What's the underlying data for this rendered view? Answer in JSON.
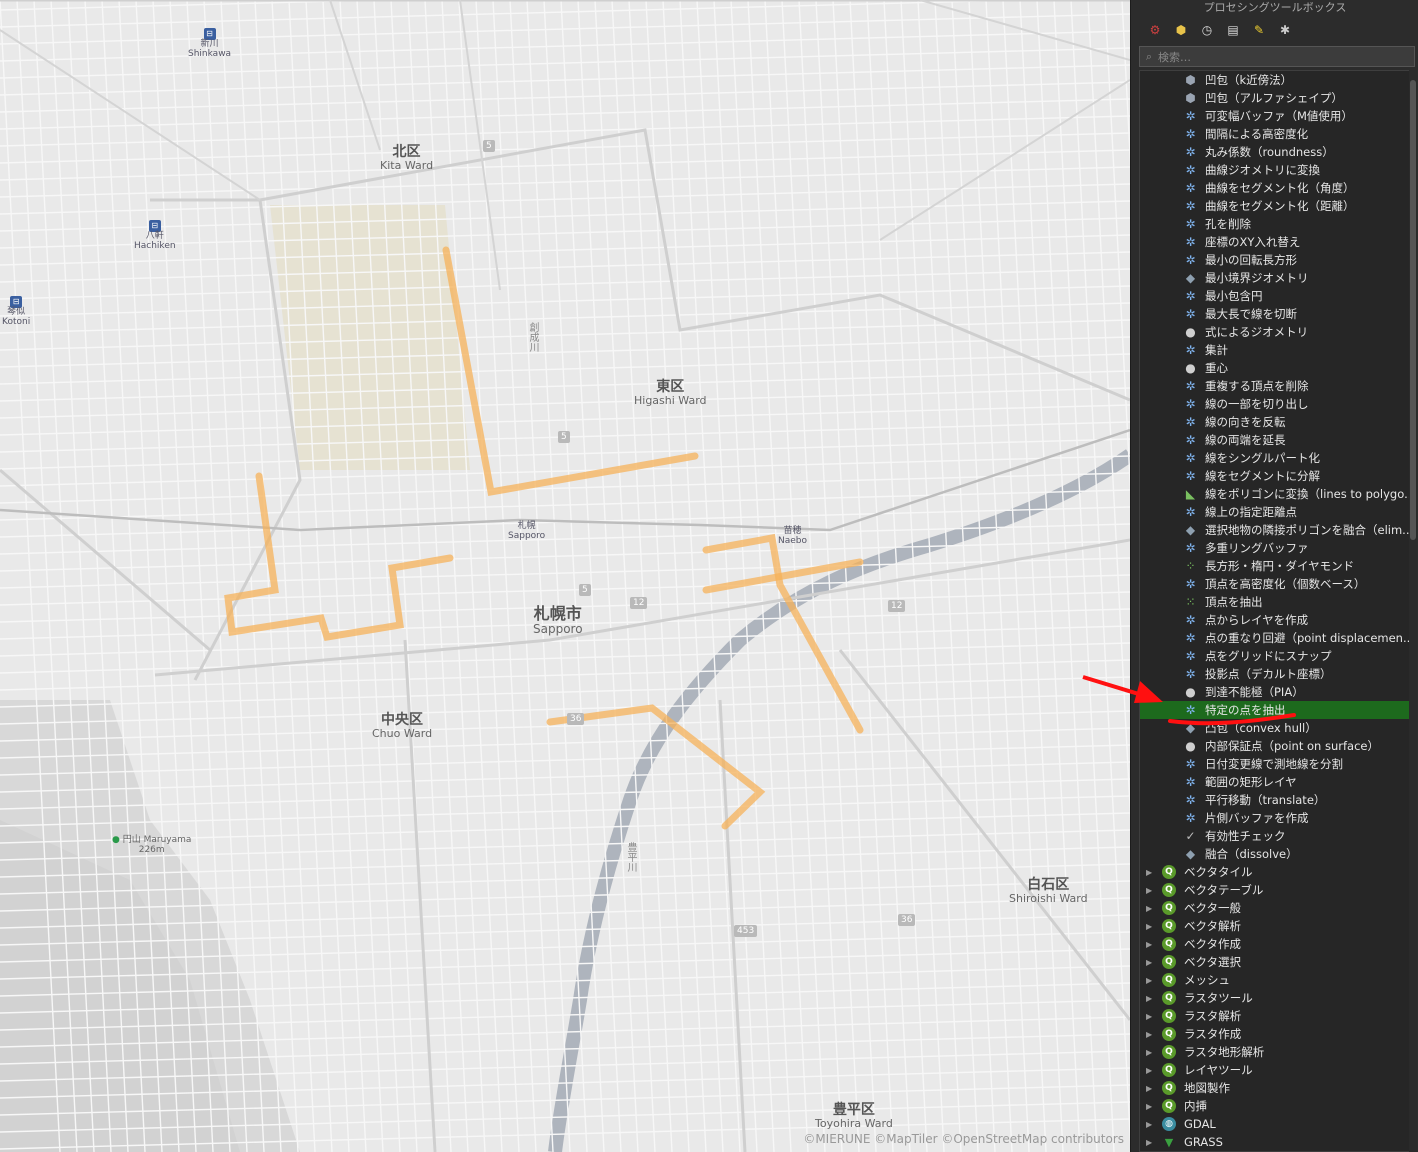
{
  "map": {
    "districts": [
      {
        "jp": "北区",
        "en": "Kita Ward"
      },
      {
        "jp": "東区",
        "en": "Higashi Ward"
      },
      {
        "jp": "札幌市",
        "en": "Sapporo"
      },
      {
        "jp": "中央区",
        "en": "Chuo Ward"
      },
      {
        "jp": "白石区",
        "en": "Shiroishi Ward"
      },
      {
        "jp": "豊平区",
        "en": "Toyohira Ward"
      }
    ],
    "stations": [
      {
        "jp": "新川",
        "en": "Shinkawa"
      },
      {
        "jp": "八軒",
        "en": "Hachiken"
      },
      {
        "jp": "琴似",
        "en": "Kotoni"
      },
      {
        "jp": "札幌",
        "en": "Sapporo"
      },
      {
        "jp": "苗穂",
        "en": "Naebo"
      }
    ],
    "peak": {
      "jp": "円山",
      "en": "Maruyama",
      "elev": "226m"
    },
    "rivers": [
      "創成川",
      "豊平川"
    ],
    "routes": [
      "5",
      "5",
      "5",
      "12",
      "12",
      "36",
      "36",
      "453"
    ],
    "attribution": "©MIERUNE ©MapTiler ©OpenStreetMap contributors",
    "overlay_color": "#f5b25a"
  },
  "panel": {
    "title": "プロセシングツールボックス",
    "toolbar": [
      {
        "name": "models-icon",
        "glyph": "⚙"
      },
      {
        "name": "python-icon",
        "glyph": "⬢"
      },
      {
        "name": "history-icon",
        "glyph": "◷"
      },
      {
        "name": "results-icon",
        "glyph": "▤"
      },
      {
        "name": "edit-features-icon",
        "glyph": "✎"
      },
      {
        "name": "options-icon",
        "glyph": "🔧"
      }
    ],
    "search_placeholder": "検索…",
    "algorithms": [
      {
        "label": "凹包（k近傍法）",
        "icon": "polygon"
      },
      {
        "label": "凹包（アルファシェイプ）",
        "icon": "polygon"
      },
      {
        "label": "可変幅バッファ（M値使用）",
        "icon": "gear"
      },
      {
        "label": "間隔による高密度化",
        "icon": "gear"
      },
      {
        "label": "丸み係数（roundness）",
        "icon": "gear"
      },
      {
        "label": "曲線ジオメトリに変換",
        "icon": "gear"
      },
      {
        "label": "曲線をセグメント化（角度）",
        "icon": "gear"
      },
      {
        "label": "曲線をセグメント化（距離）",
        "icon": "gear"
      },
      {
        "label": "孔を削除",
        "icon": "gear"
      },
      {
        "label": "座標のXY入れ替え",
        "icon": "gear"
      },
      {
        "label": "最小の回転長方形",
        "icon": "gear"
      },
      {
        "label": "最小境界ジオメトリ",
        "icon": "shape"
      },
      {
        "label": "最小包含円",
        "icon": "gear"
      },
      {
        "label": "最大長で線を切断",
        "icon": "gear"
      },
      {
        "label": "式によるジオメトリ",
        "icon": "expr"
      },
      {
        "label": "集計",
        "icon": "gear"
      },
      {
        "label": "重心",
        "icon": "expr"
      },
      {
        "label": "重複する頂点を削除",
        "icon": "gear"
      },
      {
        "label": "線の一部を切り出し",
        "icon": "gear"
      },
      {
        "label": "線の向きを反転",
        "icon": "gear"
      },
      {
        "label": "線の両端を延長",
        "icon": "gear"
      },
      {
        "label": "線をシングルパート化",
        "icon": "gear"
      },
      {
        "label": "線をセグメントに分解",
        "icon": "gear"
      },
      {
        "label": "線をポリゴンに変換（lines to polygo...",
        "icon": "line"
      },
      {
        "label": "線上の指定距離点",
        "icon": "gear"
      },
      {
        "label": "選択地物の隣接ポリゴンを融合（elim...",
        "icon": "shape"
      },
      {
        "label": "多重リングバッファ",
        "icon": "gear"
      },
      {
        "label": "長方形・楕円・ダイヤモンド",
        "icon": "points"
      },
      {
        "label": "頂点を高密度化（個数ベース）",
        "icon": "gear"
      },
      {
        "label": "頂点を抽出",
        "icon": "dots"
      },
      {
        "label": "点からレイヤを作成",
        "icon": "gear"
      },
      {
        "label": "点の重なり回避（point displacemen...",
        "icon": "gear"
      },
      {
        "label": "点をグリッドにスナップ",
        "icon": "gear"
      },
      {
        "label": "投影点（デカルト座標）",
        "icon": "gear"
      },
      {
        "label": "到達不能極（PIA）",
        "icon": "expr"
      },
      {
        "label": "特定の点を抽出",
        "icon": "gear",
        "selected": true
      },
      {
        "label": "凸包（convex hull）",
        "icon": "shape"
      },
      {
        "label": "内部保証点（point on surface）",
        "icon": "expr"
      },
      {
        "label": "日付変更線で測地線を分割",
        "icon": "gear"
      },
      {
        "label": "範囲の矩形レイヤ",
        "icon": "gear"
      },
      {
        "label": "平行移動（translate）",
        "icon": "gear"
      },
      {
        "label": "片側バッファを作成",
        "icon": "gear"
      },
      {
        "label": "有効性チェック",
        "icon": "check"
      },
      {
        "label": "融合（dissolve）",
        "icon": "shape"
      }
    ],
    "groups": [
      {
        "label": "ベクタタイル",
        "icon": "q"
      },
      {
        "label": "ベクタテーブル",
        "icon": "q"
      },
      {
        "label": "ベクタ一般",
        "icon": "q"
      },
      {
        "label": "ベクタ解析",
        "icon": "q"
      },
      {
        "label": "ベクタ作成",
        "icon": "q"
      },
      {
        "label": "ベクタ選択",
        "icon": "q"
      },
      {
        "label": "メッシュ",
        "icon": "q"
      },
      {
        "label": "ラスタツール",
        "icon": "q"
      },
      {
        "label": "ラスタ解析",
        "icon": "q"
      },
      {
        "label": "ラスタ作成",
        "icon": "q"
      },
      {
        "label": "ラスタ地形解析",
        "icon": "q"
      },
      {
        "label": "レイヤツール",
        "icon": "q"
      },
      {
        "label": "地図製作",
        "icon": "q"
      },
      {
        "label": "内挿",
        "icon": "q"
      },
      {
        "label": "GDAL",
        "icon": "gdal"
      },
      {
        "label": "GRASS",
        "icon": "grass"
      }
    ],
    "selected_color": "#1d6a1d",
    "annotation_color": "#ff0000"
  }
}
